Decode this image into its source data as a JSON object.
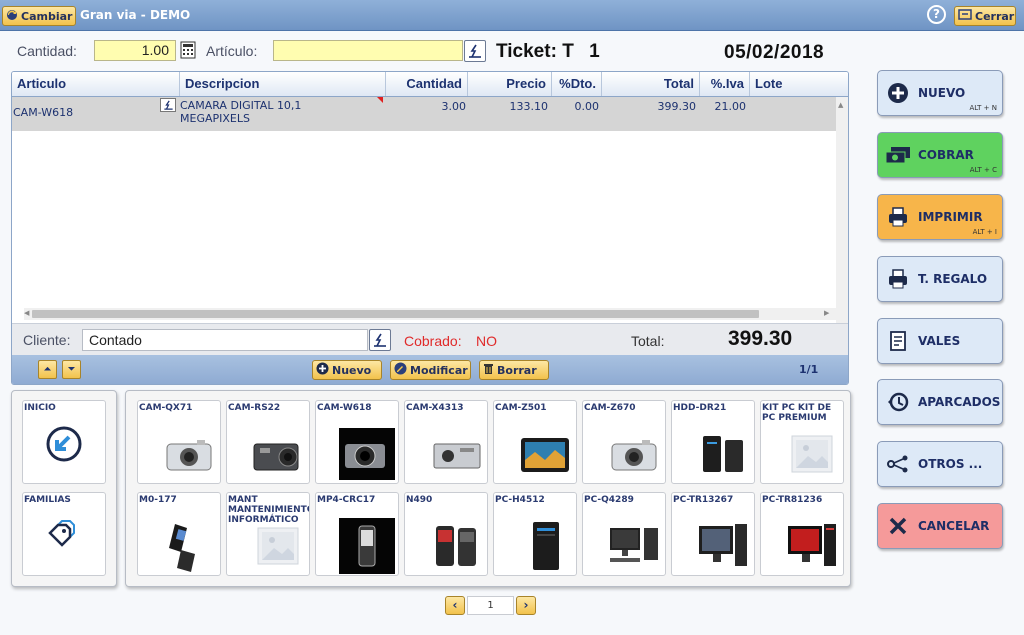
{
  "titlebar": {
    "change_label": "Cambiar",
    "title": "Gran via - DEMO",
    "help": "?",
    "close_label": "Cerrar"
  },
  "entry": {
    "cantidad_label": "Cantidad:",
    "cantidad_value": "1.00",
    "articulo_label": "Artículo:",
    "articulo_value": "",
    "ticket_label": "Ticket:",
    "ticket_series": "T",
    "ticket_number": "1",
    "date": "05/02/2018"
  },
  "table": {
    "headers": [
      "Articulo",
      "Descripcion",
      "Cantidad",
      "Precio",
      "%Dto.",
      "Total",
      "%.Iva",
      "Lote"
    ],
    "rows": [
      {
        "articulo": "CAM-W618",
        "descripcion": "CAMARA DIGITAL 10,1 MEGAPIXELS",
        "cantidad": "3.00",
        "precio": "133.10",
        "dto": "0.00",
        "total": "399.30",
        "iva": "21.00",
        "lote": ""
      }
    ]
  },
  "client": {
    "label": "Cliente:",
    "value": "Contado",
    "cobrado_label": "Cobrado:",
    "cobrado_value": "NO",
    "total_label": "Total:",
    "total_value": "399.30"
  },
  "linebar": {
    "nuevo": "Nuevo",
    "modificar": "Modificar",
    "borrar": "Borrar",
    "page": "1/1"
  },
  "nav": {
    "inicio": "INICIO",
    "familias": "FAMILIAS"
  },
  "products": [
    {
      "code": "CAM-QX71",
      "icon": "camera-silver"
    },
    {
      "code": "CAM-RS22",
      "icon": "camera-dark"
    },
    {
      "code": "CAM-W618",
      "icon": "camera-black"
    },
    {
      "code": "CAM-X4313",
      "icon": "camera-silver-flat"
    },
    {
      "code": "CAM-Z501",
      "icon": "camera-screen"
    },
    {
      "code": "CAM-Z670",
      "icon": "camera-silver"
    },
    {
      "code": "HDD-DR21",
      "icon": "hdd-black"
    },
    {
      "code": "KIT PC KIT DE PC PREMIUM",
      "icon": "placeholder-image"
    },
    {
      "code": "M0-177",
      "icon": "phone-flip"
    },
    {
      "code": "MANT MANTENIMIENTO INFORMÁTICO",
      "icon": "placeholder-image"
    },
    {
      "code": "MP4-CRC17",
      "icon": "mp4-player"
    },
    {
      "code": "N490",
      "icon": "phones-pair"
    },
    {
      "code": "PC-H4512",
      "icon": "desktop-tower"
    },
    {
      "code": "PC-Q4289",
      "icon": "desktop-set"
    },
    {
      "code": "PC-TR13267",
      "icon": "desktop-monitor"
    },
    {
      "code": "PC-TR81236",
      "icon": "desktop-red"
    }
  ],
  "pager": {
    "page": "1"
  },
  "actions": [
    {
      "label": "NUEVO",
      "shortcut": "ALT + N",
      "color": "#dde9f7",
      "icon": "plus-circle-icon"
    },
    {
      "label": "COBRAR",
      "shortcut": "ALT + C",
      "color": "#5fd25f",
      "icon": "money-icon"
    },
    {
      "label": "IMPRIMIR",
      "shortcut": "ALT + I",
      "color": "#f7b54a",
      "icon": "printer-icon"
    },
    {
      "label": "T. REGALO",
      "shortcut": "",
      "color": "#dde9f7",
      "icon": "gift-ticket-icon"
    },
    {
      "label": "VALES",
      "shortcut": "",
      "color": "#dde9f7",
      "icon": "voucher-icon"
    },
    {
      "label": "APARCADOS",
      "shortcut": "",
      "color": "#dde9f7",
      "icon": "parked-icon"
    },
    {
      "label": "OTROS ...",
      "shortcut": "",
      "color": "#dde9f7",
      "icon": "share-icon"
    },
    {
      "label": "CANCELAR",
      "shortcut": "",
      "color": "#f59a9a",
      "icon": "x-icon"
    }
  ]
}
